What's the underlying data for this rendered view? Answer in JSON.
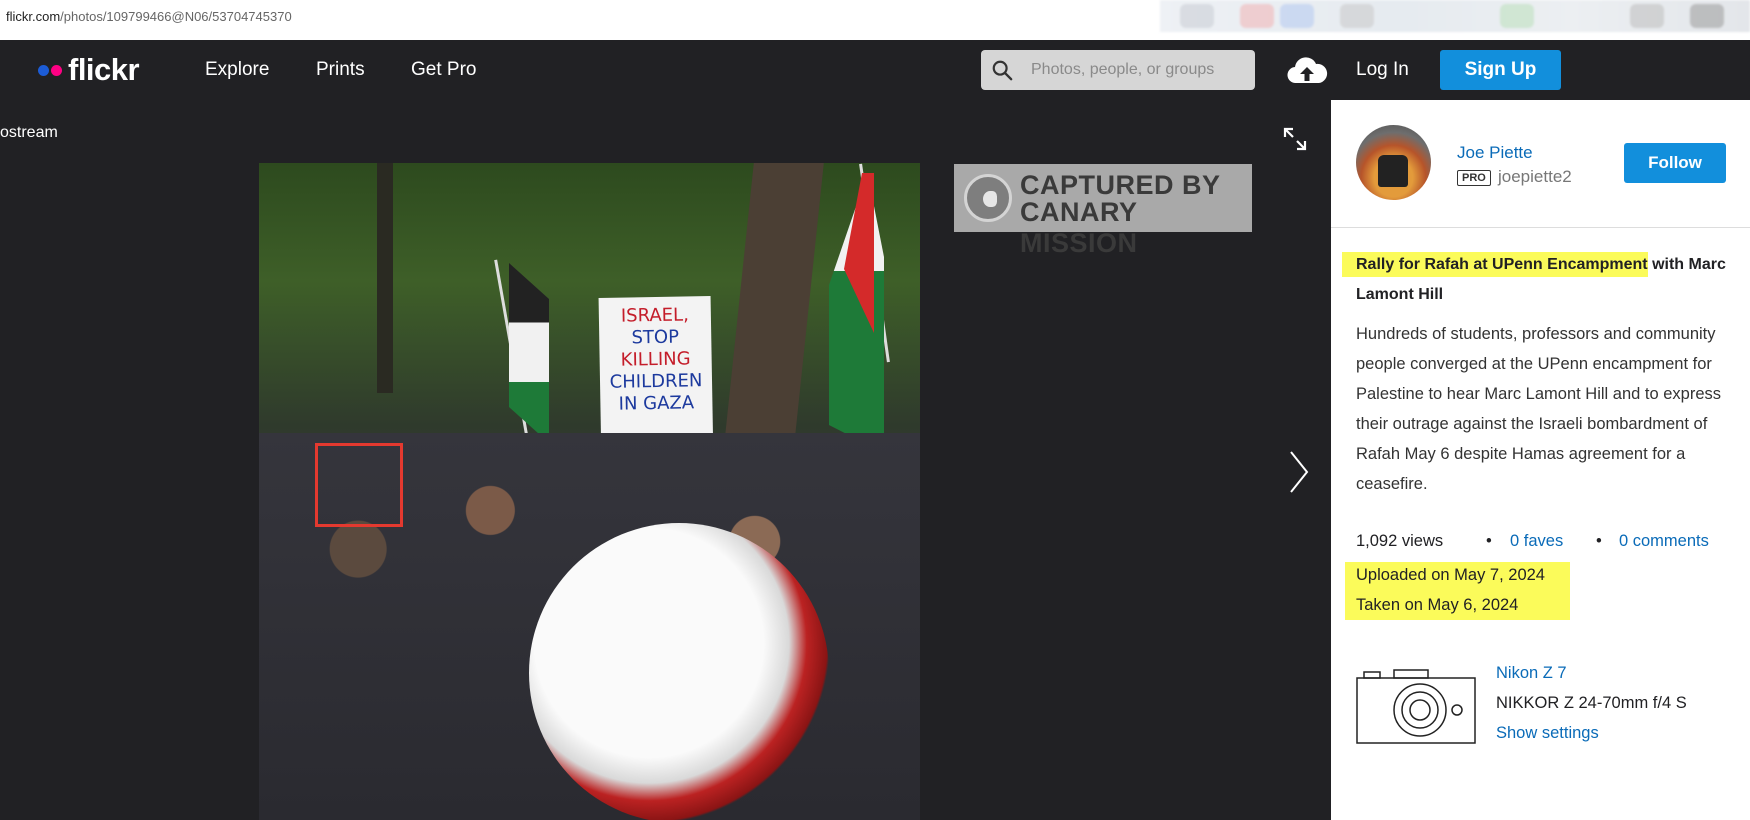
{
  "browser": {
    "url_domain": "flickr.com",
    "url_path": "/photos/109799466@N06/53704745370"
  },
  "nav": {
    "logo": "flickr",
    "links": [
      "Explore",
      "Prints",
      "Get Pro"
    ],
    "search_placeholder": "Photos, people, or groups",
    "login": "Log In",
    "signup": "Sign Up"
  },
  "viewer": {
    "back_label": "ostream",
    "sign_lines": [
      "ISRAEL,",
      "STOP",
      "KILLING",
      "CHILDREN",
      "IN GAZA"
    ],
    "watermark_line1": "CAPTURED BY",
    "watermark_line2": "CANARY MISSION"
  },
  "sidebar": {
    "author_name": "Joe Piette",
    "pro_badge": "PRO",
    "username": "joepiette2",
    "follow": "Follow",
    "title_highlighted": "Rally for Rafah at UPenn Encampment",
    "title_rest": " with Marc Lamont Hill",
    "description": "Hundreds of students, professors and community people converged at the UPenn encampment for Palestine to hear Marc Lamont Hill and to express their outrage against the Israeli bombardment of Rafah May 6 despite Hamas agreement for a ceasefire.",
    "views": "1,092 views",
    "bullet": "•",
    "faves": "0 faves",
    "comments": "0 comments",
    "uploaded": "Uploaded on May 7, 2024",
    "taken": "Taken on May 6, 2024",
    "camera": "Nikon Z 7",
    "lens": "NIKKOR Z 24-70mm f/4 S",
    "show_settings": "Show settings"
  },
  "colors": {
    "nav_bg": "#212124",
    "accent_blue": "#128fdc",
    "link_blue": "#0a6bb8",
    "highlight": "#fbfb5a",
    "red_box": "#e4392f"
  }
}
